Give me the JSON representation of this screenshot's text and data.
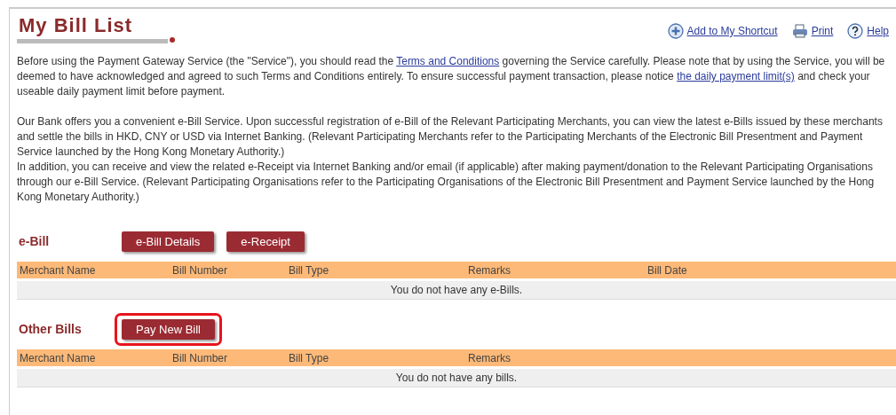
{
  "title": "My Bill List",
  "actions": [
    {
      "kind": "shortcut",
      "label": "Add to My Shortcut"
    },
    {
      "kind": "print",
      "label": "Print"
    },
    {
      "kind": "help",
      "label": "Help"
    }
  ],
  "paragraphs": [
    [
      {
        "kind": "text",
        "text": "Before using the Payment Gateway Service (the \"Service\"), you should read the "
      },
      {
        "kind": "link",
        "text": "Terms and Conditions"
      },
      {
        "kind": "text",
        "text": " governing the Service carefully. Please note that by using the Service, you will be deemed to have acknowledged and agreed to such Terms and Conditions entirely. To ensure successful payment transaction, please notice "
      },
      {
        "kind": "link",
        "text": "the daily payment limit(s)"
      },
      {
        "kind": "text",
        "text": " and check your useable daily payment limit before payment."
      }
    ],
    [
      {
        "kind": "text",
        "text": "Our Bank offers you a convenient e-Bill Service. Upon successful registration of e-Bill of the Relevant Participating Merchants, you can view the latest e-Bills issued by these merchants and settle the bills in HKD, CNY or USD via Internet Banking. (Relevant Participating Merchants refer to the Participating Merchants of the Electronic Bill Presentment and Payment Service launched by the Hong Kong Monetary Authority.)"
      }
    ],
    [
      {
        "kind": "text",
        "text": "In addition, you can receive and view the related e-Receipt via Internet Banking and/or email (if applicable) after making payment/donation to the Relevant Participating Organisations through our e-Bill Service. (Relevant Participating Organisations refer to the Participating Organisations of the Electronic Bill Presentment and Payment Service launched by the Hong Kong Monetary Authority.)"
      }
    ]
  ],
  "sections": [
    {
      "heading": "e-Bill",
      "buttons": [
        {
          "label": "e-Bill Details",
          "highlighted": false
        },
        {
          "label": "e-Receipt",
          "highlighted": false
        }
      ],
      "table": {
        "columns": [
          "Merchant Name",
          "Bill Number",
          "Bill Type",
          "Remarks",
          "Bill Date"
        ],
        "empty_message": "You do not have any e-Bills."
      }
    },
    {
      "heading": "Other Bills",
      "buttons": [
        {
          "label": "Pay New Bill",
          "highlighted": true
        }
      ],
      "table": {
        "columns": [
          "Merchant Name",
          "Bill Number",
          "Bill Type",
          "Remarks"
        ],
        "empty_message": "You do not have any bills."
      }
    }
  ]
}
